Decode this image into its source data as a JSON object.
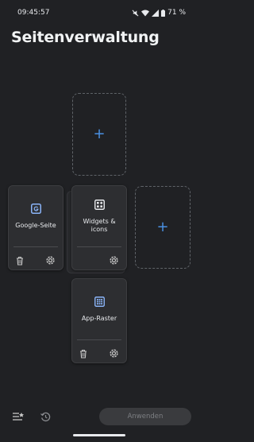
{
  "status_bar": {
    "time": "09:45:57",
    "battery": "71 %"
  },
  "title": "Seitenverwaltung",
  "empty_slots": {
    "add_label": "+"
  },
  "cards": {
    "google": {
      "label": "Google-Seite",
      "icon": "google-page-icon"
    },
    "widgets": {
      "label_line1": "Widgets &",
      "label_line2": "icons",
      "icon": "widgets-icon"
    },
    "apps": {
      "label": "App-Raster",
      "icon": "app-grid-icon"
    }
  },
  "bottom_bar": {
    "apply_label": "Anwenden"
  },
  "colors": {
    "background": "#202124",
    "accent": "#4a90e2",
    "card": "#2d2e31"
  }
}
